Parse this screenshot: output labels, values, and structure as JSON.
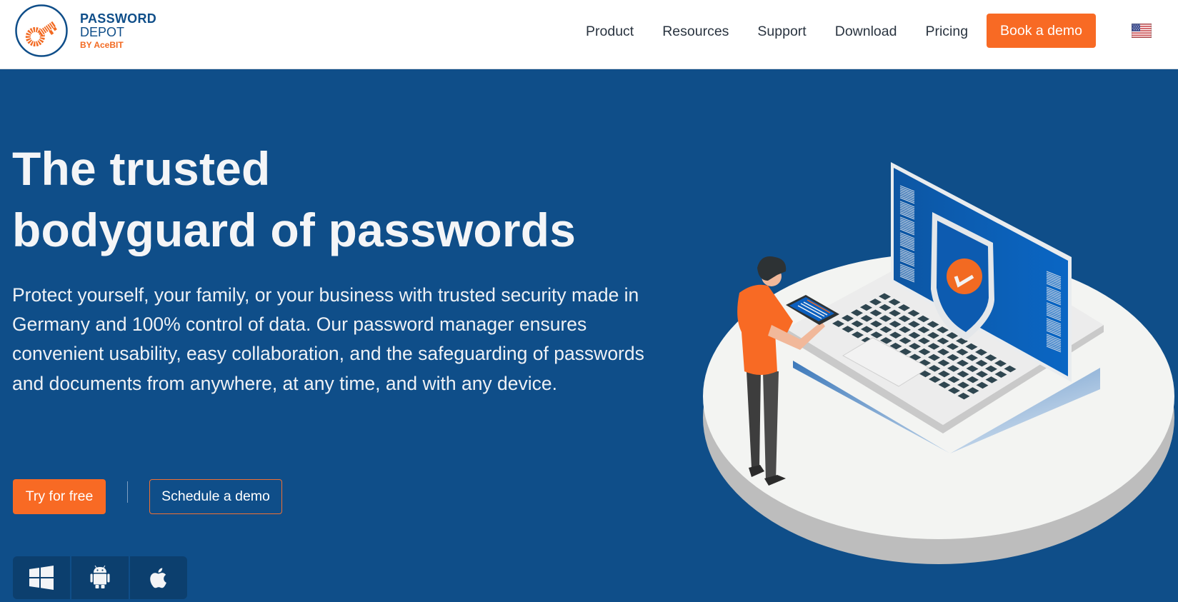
{
  "header": {
    "logo": {
      "line1": "PASSWORD",
      "line2": "DEPOT",
      "line3": "BY AceBIT",
      "icon": "key-logo-icon"
    },
    "nav": [
      {
        "label": "Product"
      },
      {
        "label": "Resources"
      },
      {
        "label": "Support"
      },
      {
        "label": "Download"
      },
      {
        "label": "Pricing"
      }
    ],
    "cta_label": "Book a demo",
    "language_flag": "us-flag-icon"
  },
  "hero": {
    "title_line1": "The trusted",
    "title_line2": "bodyguard of passwords",
    "description": "Protect yourself, your family, or your business with trusted security made in Germany and 100% control of data. Our password manager ensures convenient usability, easy collaboration, and the safeguarding of passwords and documents from anywhere, at any time, and with any device.",
    "primary_button": "Try for free",
    "secondary_button": "Schedule a demo",
    "platforms": [
      {
        "name": "Windows",
        "icon": "windows-icon"
      },
      {
        "name": "Android",
        "icon": "android-icon"
      },
      {
        "name": "Apple",
        "icon": "apple-icon"
      }
    ]
  },
  "colors": {
    "brand_blue": "#0f4e89",
    "accent_orange": "#f86a24",
    "header_bg": "#ffffff"
  }
}
